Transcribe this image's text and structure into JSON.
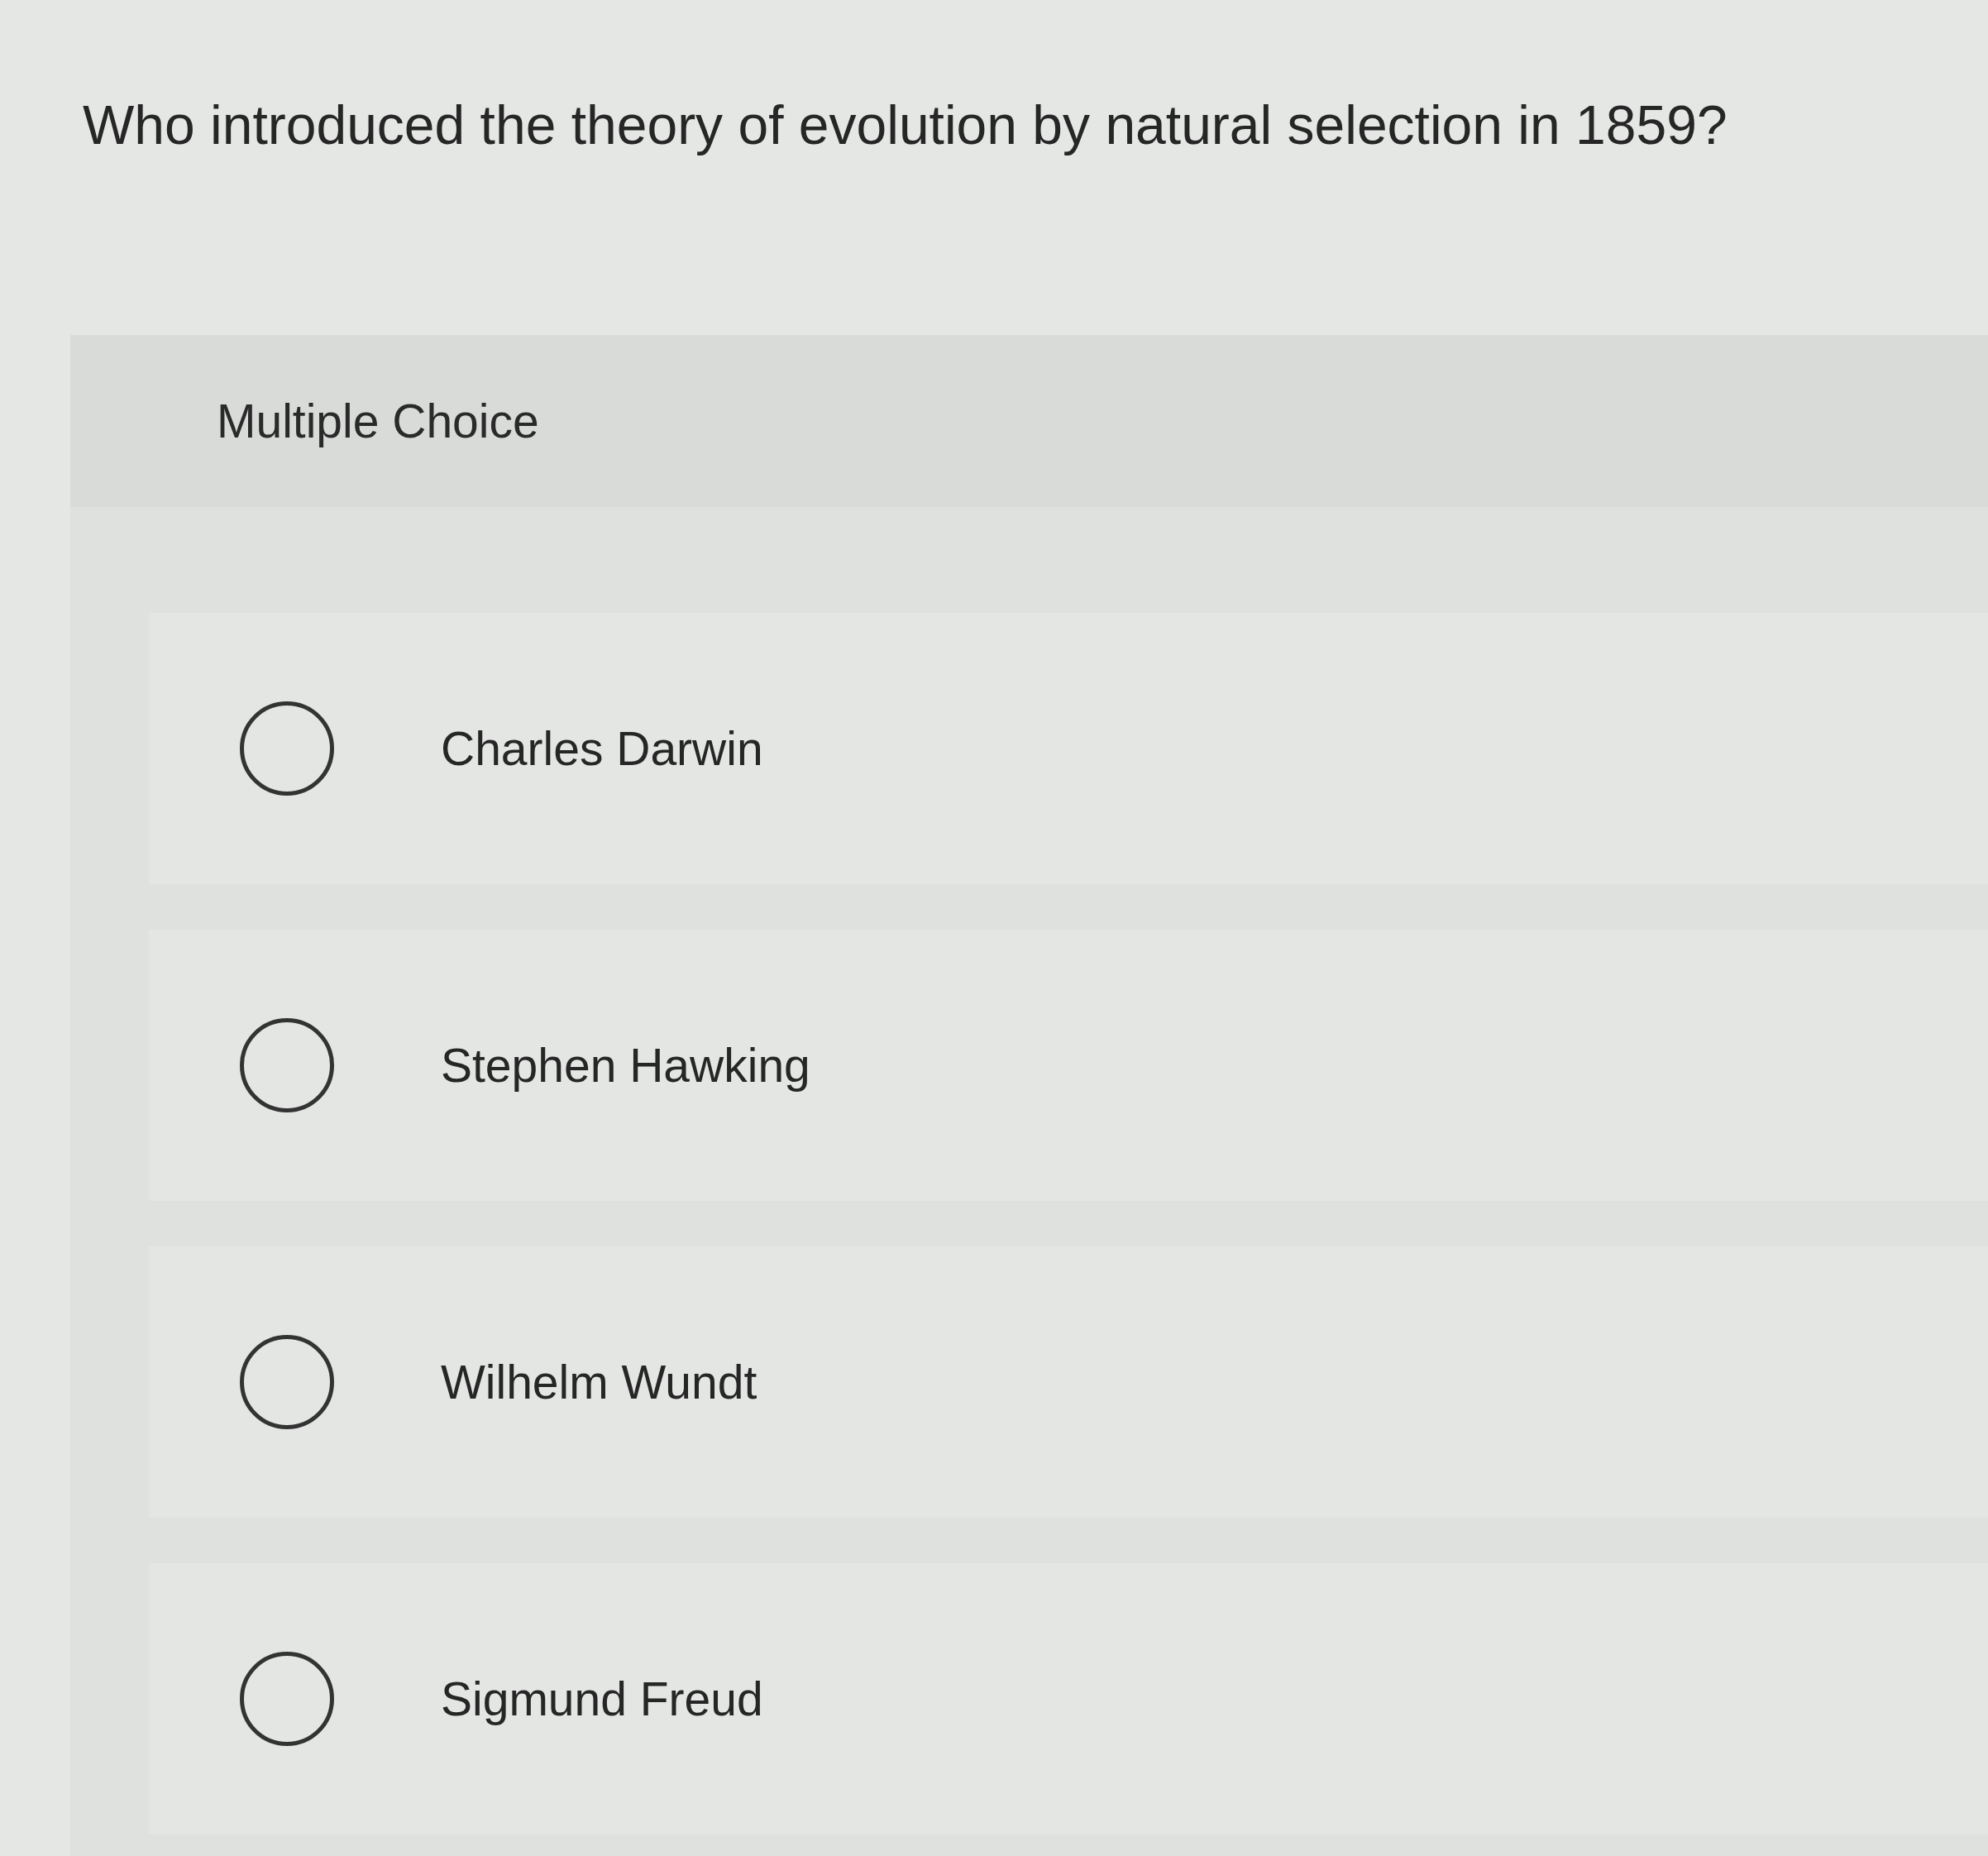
{
  "question": {
    "text": "Who introduced the theory of evolution by natural selection in 1859?"
  },
  "answer_panel": {
    "type_label": "Multiple Choice",
    "options": [
      {
        "label": "Charles Darwin",
        "selected": false
      },
      {
        "label": "Stephen Hawking",
        "selected": false
      },
      {
        "label": "Wilhelm Wundt",
        "selected": false
      },
      {
        "label": "Sigmund Freud",
        "selected": false
      }
    ]
  }
}
